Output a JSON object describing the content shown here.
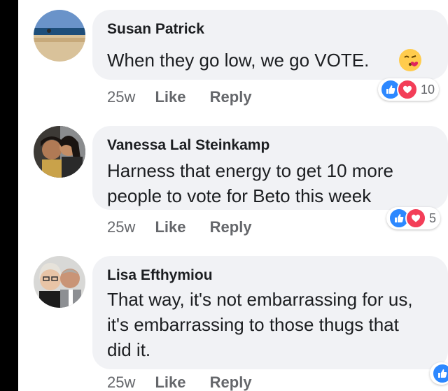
{
  "comments": [
    {
      "author": "Susan Patrick",
      "lines": [
        "When they go low, we go VOTE."
      ],
      "time": "25w",
      "like_label": "Like",
      "reply_label": "Reply",
      "reaction_count": "10",
      "reactions": [
        "like-icon",
        "love-icon"
      ],
      "emoji": "kissing-heart-emoji-icon"
    },
    {
      "author": "Vanessa Lal Steinkamp",
      "lines": [
        "Harness that energy to get 10 more",
        "people to vote for Beto this week"
      ],
      "time": "25w",
      "like_label": "Like",
      "reply_label": "Reply",
      "reaction_count": "5",
      "reactions": [
        "like-icon",
        "love-icon"
      ]
    },
    {
      "author": "Lisa Efthymiou",
      "lines": [
        "That way, it's not embarrassing for us,",
        "it's embarrassing to those thugs that",
        "did it."
      ],
      "time": "25w",
      "like_label": "Like",
      "reply_label": "Reply",
      "reactions": [
        "like-icon"
      ]
    }
  ],
  "colors": {
    "bubble": "#f1f2f5",
    "like_blue": "#2d88ff",
    "love_red": "#f33e58",
    "meta_gray": "#65676b",
    "left_strip": "#000000"
  }
}
